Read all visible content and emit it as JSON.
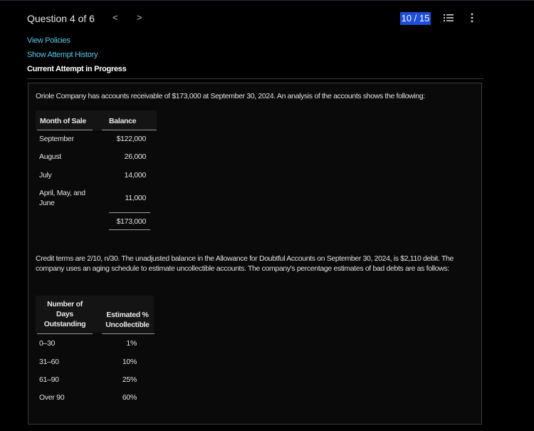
{
  "header": {
    "question_label": "Question 4 of 6",
    "prev_glyph": "<",
    "next_glyph": ">",
    "progress": "10 / 15",
    "list_icon": "list-icon",
    "more_icon": "more-vertical-icon"
  },
  "links": {
    "view_policies": "View Policies",
    "show_attempt_history": "Show Attempt History"
  },
  "status": "Current Attempt in Progress",
  "question": {
    "intro": "Oriole Company has accounts receivable of $173,000 at September 30, 2024. An analysis of the accounts shows the following:",
    "table1": {
      "headers": [
        "Month of Sale",
        "Balance"
      ],
      "rows": [
        [
          "September",
          "$122,000"
        ],
        [
          "August",
          "26,000"
        ],
        [
          "July",
          "14,000"
        ],
        [
          "April, May, and June",
          "11,000"
        ]
      ],
      "total": "$173,000"
    },
    "paragraph2": "Credit terms are 2/10, n/30. The unadjusted balance in the Allowance for Doubtful Accounts on September 30, 2024, is $2,110 debit. The company uses an aging schedule to estimate uncollectible accounts. The company's percentage estimates of bad debts are as follows:",
    "table2": {
      "headers": [
        "Number of Days Outstanding",
        "Estimated % Uncollectible"
      ],
      "rows": [
        [
          "0–30",
          "1%"
        ],
        [
          "31–60",
          "10%"
        ],
        [
          "61–90",
          "25%"
        ],
        [
          "Over 90",
          "60%"
        ]
      ]
    }
  },
  "colors": {
    "background": "#000000",
    "link": "#56c7ea",
    "badge": "#1d4fd8"
  }
}
